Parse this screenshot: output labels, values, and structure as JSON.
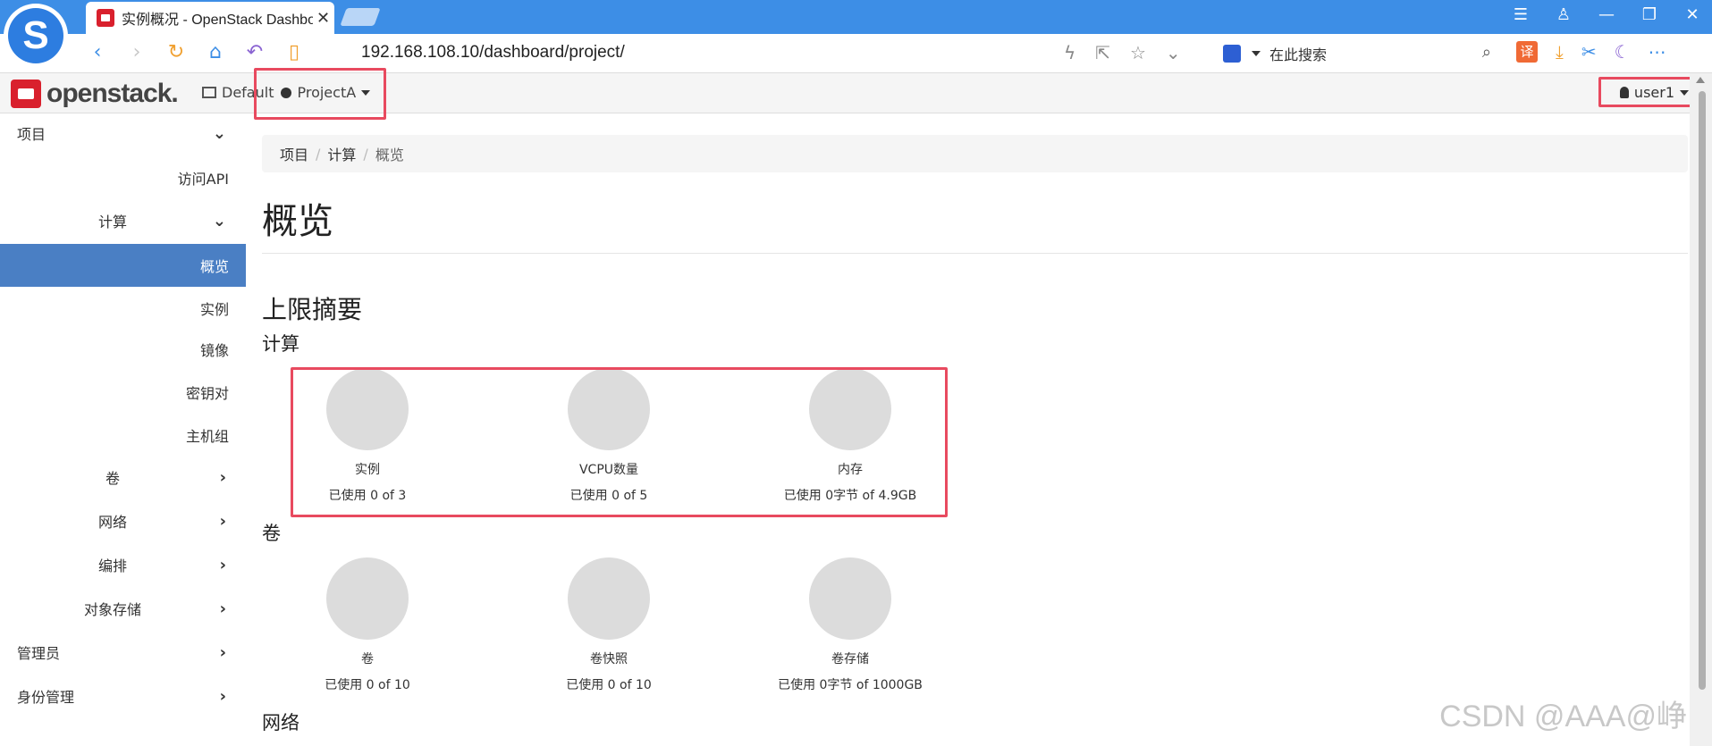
{
  "browser": {
    "tab_title": "实例概况 - OpenStack Dashboard",
    "url": "192.168.108.10/dashboard/project/",
    "search_placeholder": "在此搜索",
    "translate_label": "译"
  },
  "header": {
    "brand": "openstack.",
    "domain": "Default",
    "project": "ProjectA",
    "user": "user1"
  },
  "sidebar": {
    "project": "项目",
    "access_api": "访问API",
    "compute": "计算",
    "overview": "概览",
    "instances": "实例",
    "images": "镜像",
    "key_pairs": "密钥对",
    "server_groups": "主机组",
    "volumes": "卷",
    "network": "网络",
    "orchestration": "编排",
    "object_store": "对象存储",
    "admin": "管理员",
    "identity": "身份管理"
  },
  "breadcrumb": [
    "项目",
    "计算",
    "概览"
  ],
  "page_title": "概览",
  "limits_title": "上限摘要",
  "sections": {
    "compute": "计算",
    "volume": "卷",
    "network": "网络"
  },
  "compute_limits": [
    {
      "label": "实例",
      "usage": "已使用 0 of 3"
    },
    {
      "label": "VCPU数量",
      "usage": "已使用 0 of 5"
    },
    {
      "label": "内存",
      "usage": "已使用 0字节 of 4.9GB"
    }
  ],
  "volume_limits": [
    {
      "label": "卷",
      "usage": "已使用 0 of 10"
    },
    {
      "label": "卷快照",
      "usage": "已使用 0 of 10"
    },
    {
      "label": "卷存储",
      "usage": "已使用 0字节 of 1000GB"
    }
  ],
  "watermark": "CSDN @AAA@峥",
  "colors": {
    "accent": "#4a7fc4",
    "highlight": "#e84a5f",
    "brand": "#d9202d",
    "pie": "#dcdcdc"
  }
}
